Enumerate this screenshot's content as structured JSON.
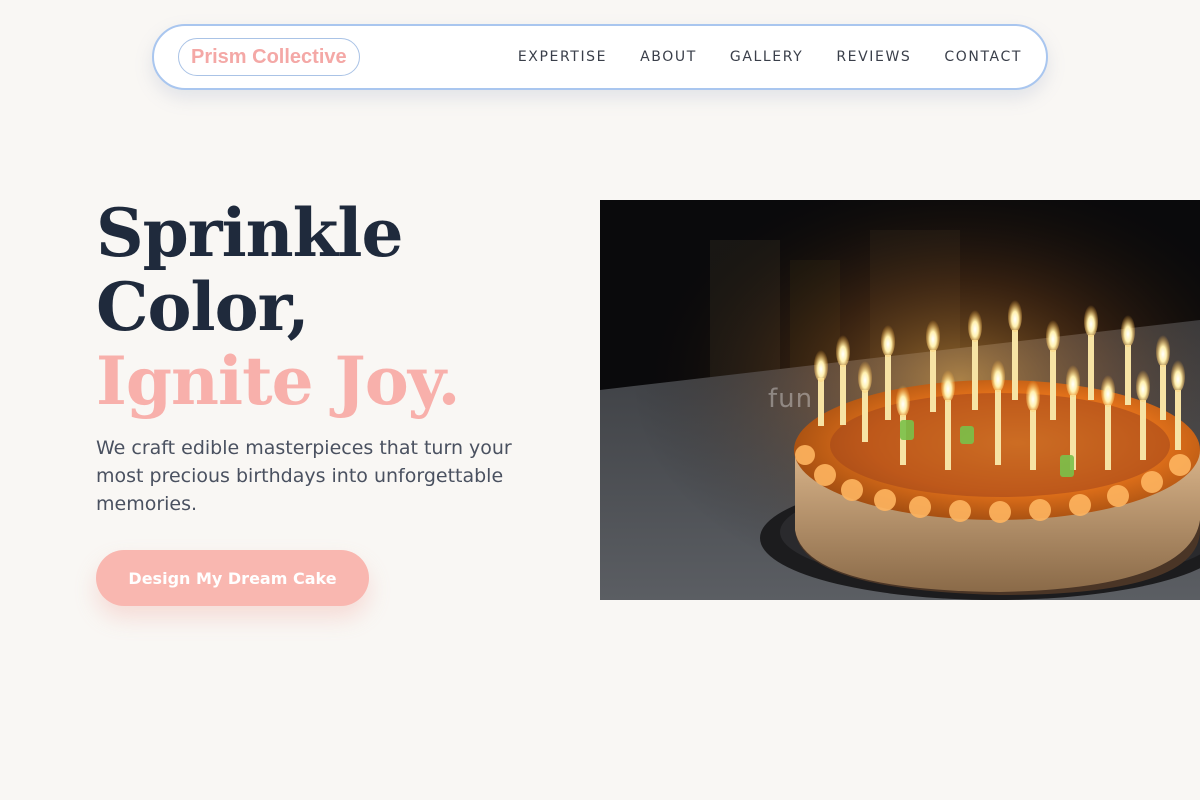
{
  "nav": {
    "brand": "Prism Collective",
    "links": [
      {
        "label": "EXPERTISE"
      },
      {
        "label": "ABOUT"
      },
      {
        "label": "GALLERY"
      },
      {
        "label": "REVIEWS"
      },
      {
        "label": "CONTACT"
      }
    ]
  },
  "hero": {
    "title_line1": "Sprinkle",
    "title_line2": "Color,",
    "title_accent": "Ignite Joy.",
    "description": "We craft edible masterpieces that turn your most precious birthdays into unforgettable memories.",
    "cta_label": "Design My Dream Cake",
    "image": {
      "subject": "birthday cake with lit candles",
      "watermark": "fun"
    }
  },
  "colors": {
    "background": "#f9f7f4",
    "brand_pink": "#f4a8a6",
    "accent_pink": "#f8b0ab",
    "button_pink": "#f9b7b0",
    "heading_navy": "#1f2a3c",
    "nav_border_blue": "#a9c6ef"
  }
}
